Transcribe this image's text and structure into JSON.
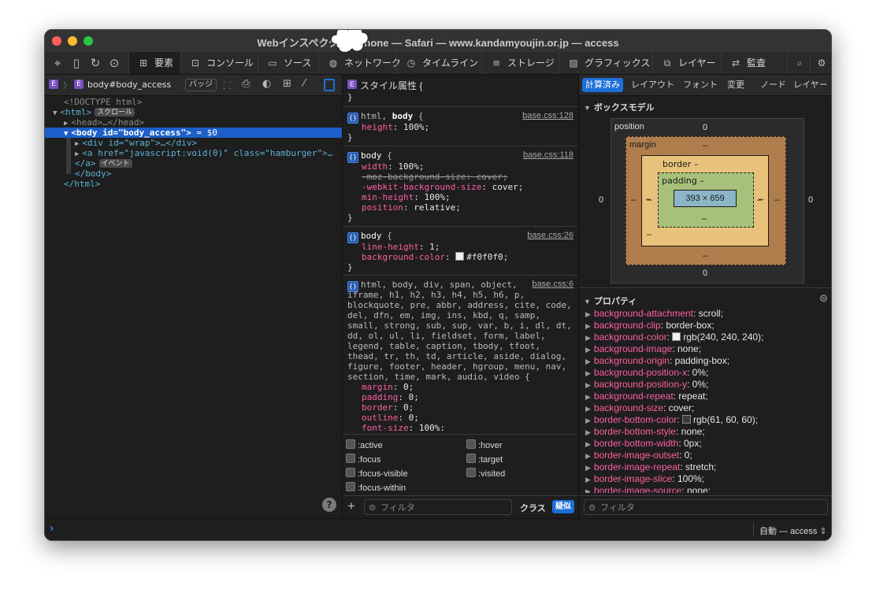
{
  "window": {
    "title": "Webインスペクタ — iPhone — Safari — www.kandamyoujin.or.jp — access"
  },
  "toolbar": {
    "icons": [
      "crosshair-icon",
      "device-icon",
      "reload-icon",
      "download-icon"
    ],
    "tabs": [
      {
        "label": "要素",
        "icon": "elements-icon"
      },
      {
        "label": "コンソール",
        "icon": "console-icon"
      },
      {
        "label": "ソース",
        "icon": "sources-icon"
      },
      {
        "label": "ネットワーク",
        "icon": "network-icon"
      },
      {
        "label": "タイムライン",
        "icon": "timeline-icon"
      },
      {
        "label": "ストレージ",
        "icon": "storage-icon"
      },
      {
        "label": "グラフィックス",
        "icon": "graphics-icon"
      },
      {
        "label": "レイヤー",
        "icon": "layers-icon"
      },
      {
        "label": "監査",
        "icon": "audit-icon"
      }
    ]
  },
  "dom": {
    "breadcrumb": "body#body_access",
    "badge_button": "バッジ",
    "lines": {
      "doctype": "<!DOCTYPE html>",
      "html_open": "<html>",
      "html_badge": "スクロール",
      "head": "<head>…</head>",
      "body_tag": "<body id=\"body_access\">",
      "body_suffix": " = $0",
      "div": "<div id=\"wrap\">…</div>",
      "a_open": "<a href=\"javascript:void(0)\" class=\"hamburger\">…",
      "a_close": "</a>",
      "event_badge": "イベント",
      "body_close": "</body>",
      "html_close": "</html>"
    }
  },
  "styles": {
    "header_label": "スタイル属性",
    "rules": [
      {
        "selector": "html, body",
        "source": "base.css:128",
        "props": [
          [
            "height",
            "100%"
          ]
        ]
      },
      {
        "selector": "body",
        "source": "base.css:118",
        "props": [
          [
            "width",
            "100%"
          ],
          [
            "-moz-background-size",
            "cover"
          ],
          [
            "-webkit-background-size",
            "cover"
          ],
          [
            "min-height",
            "100%"
          ],
          [
            "position",
            "relative"
          ]
        ]
      },
      {
        "selector": "body",
        "source": "base.css:26",
        "props": [
          [
            "line-height",
            "1"
          ],
          [
            "background-color",
            "#f0f0f0"
          ]
        ]
      },
      {
        "selector_lines": [
          "html, body, div, span, object,",
          "iframe, h1, h2, h3, h4, h5, h6, p,",
          "blockquote, pre, abbr, address, cite, code,",
          "del, dfn, em, img, ins, kbd, q, samp,",
          "small, strong, sub, sup, var, b, i, dl, dt,",
          "dd, ol, ul, li, fieldset, form, label,",
          "legend, table, caption, tbody, tfoot,",
          "thead, tr, th, td, article, aside, dialog,",
          "figure, footer, header, hgroup, menu, nav,",
          "section, time, mark, audio, video {"
        ],
        "source": "base.css:6",
        "props": [
          [
            "margin",
            "0"
          ],
          [
            "padding",
            "0"
          ],
          [
            "border",
            "0"
          ],
          [
            "outline",
            "0"
          ],
          [
            "font-size",
            "100%"
          ]
        ]
      }
    ],
    "pseudo": [
      ":active",
      ":hover",
      ":focus",
      ":target",
      ":focus-visible",
      ":visited",
      ":focus-within"
    ],
    "filter_placeholder": "フィルタ",
    "class_label": "クラス",
    "pseudo_label": "疑似"
  },
  "sidebar": {
    "tabs": [
      "計算済み",
      "レイアウト",
      "フォント",
      "変更",
      "ノード",
      "レイヤー"
    ],
    "boxmodel_title": "ボックスモデル",
    "boxmodel": {
      "position_label": "position",
      "position_top": "0",
      "position_left": "0",
      "position_right": "0",
      "position_bottom": "0",
      "margin_label": "margin",
      "margin_top": "–",
      "margin_left": "–",
      "margin_right": "–",
      "margin_bottom": "–",
      "border_label": "border",
      "border_top": "–",
      "border_left": "–",
      "border_right": "–",
      "border_bottom": "–",
      "padding_label": "padding",
      "padding_top": "–",
      "padding_left": "–",
      "padding_right": "–",
      "padding_bottom": "–",
      "content": "393 × 659"
    },
    "properties_title": "プロパティ",
    "properties": [
      [
        "background-attachment",
        "scroll"
      ],
      [
        "background-clip",
        "border-box"
      ],
      [
        "background-color",
        "rgb(240, 240, 240)"
      ],
      [
        "background-image",
        "none"
      ],
      [
        "background-origin",
        "padding-box"
      ],
      [
        "background-position-x",
        "0%"
      ],
      [
        "background-position-y",
        "0%"
      ],
      [
        "background-repeat",
        "repeat"
      ],
      [
        "background-size",
        "cover"
      ],
      [
        "border-bottom-color",
        "rgb(61, 60, 60)"
      ],
      [
        "border-bottom-style",
        "none"
      ],
      [
        "border-bottom-width",
        "0px"
      ],
      [
        "border-image-outset",
        "0"
      ],
      [
        "border-image-repeat",
        "stretch"
      ],
      [
        "border-image-slice",
        "100%"
      ],
      [
        "border-image-source",
        "none"
      ]
    ],
    "filter_placeholder": "フィルタ"
  },
  "statusbar": {
    "target": "自動 — access"
  },
  "colors": {
    "accent": "#1c6fd6",
    "margin": "#b07d4d",
    "border": "#e8c27a",
    "padding": "#a8c17a",
    "content": "#8cb6c8"
  }
}
